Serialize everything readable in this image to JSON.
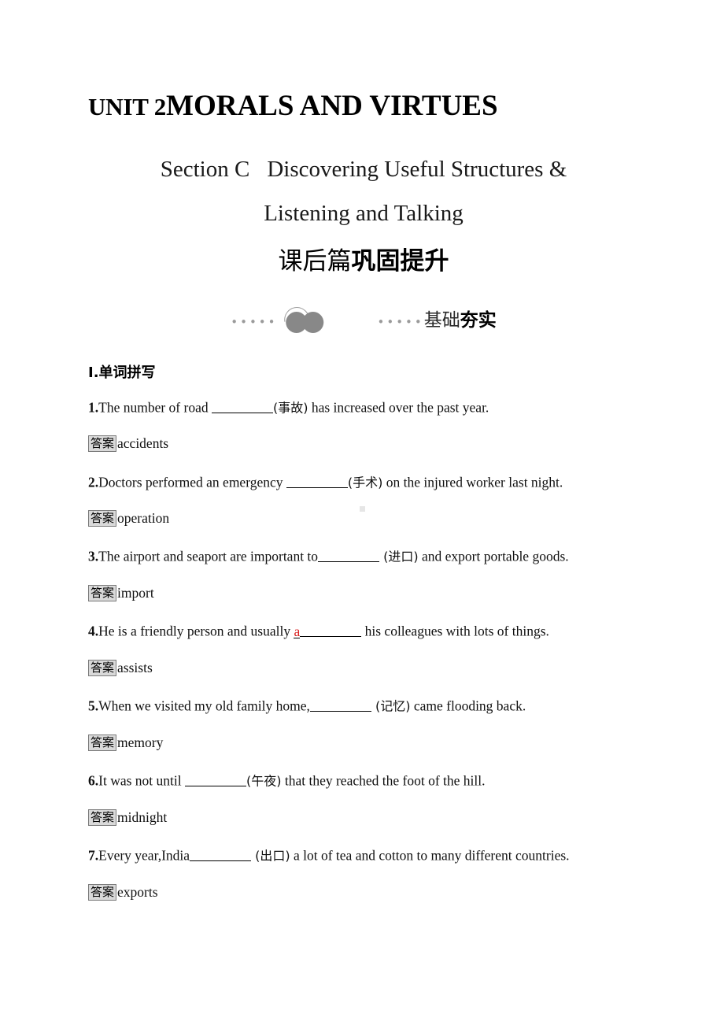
{
  "document": {
    "unit_title_prefix": "UNIT 2",
    "unit_title_main": "MORALS AND VIRTUES",
    "section_line1_a": "Section C",
    "section_line1_b": "Discovering Useful Structures &",
    "section_line2": "Listening and Talking",
    "banner_light": "课后篇",
    "banner_heavy": "巩固提升",
    "deco_label_light": "基础",
    "deco_label_heavy": "夯实",
    "deco_dots_left": "•••••",
    "deco_dots_right": "•••••",
    "section_heading": "Ⅰ.单词拼写",
    "answer_badge": "答案"
  },
  "questions": [
    {
      "num": "1.",
      "text_before": "The number of road ",
      "blank": true,
      "pre_letter": "",
      "hint": "(事故)",
      "text_after": " has increased over the past year.",
      "answer": "accidents"
    },
    {
      "num": "2.",
      "text_before": "Doctors performed an emergency ",
      "blank": true,
      "pre_letter": "",
      "hint": "(手术)",
      "text_after": " on the injured worker last night.",
      "answer": "operation"
    },
    {
      "num": "3.",
      "text_before": "The airport and seaport are important to",
      "blank": true,
      "pre_letter": "",
      "hint": " (进口)",
      "text_after": " and export portable goods.",
      "answer": "import"
    },
    {
      "num": "4.",
      "text_before": "He is a friendly person and usually ",
      "blank": true,
      "pre_letter": "a",
      "hint": "",
      "text_after": " his colleagues with lots of things.",
      "answer": "assists"
    },
    {
      "num": "5.",
      "text_before": "When we visited my old family home,",
      "blank": true,
      "pre_letter": "",
      "hint": " (记忆)",
      "text_after": " came flooding back.",
      "answer": "memory"
    },
    {
      "num": "6.",
      "text_before": "It was not until ",
      "blank": true,
      "pre_letter": "",
      "hint": "(午夜)",
      "text_after": " that they reached the foot of the hill.",
      "answer": "midnight"
    },
    {
      "num": "7.",
      "text_before": "Every year,India",
      "blank": true,
      "pre_letter": "",
      "hint": " (出口)",
      "text_after": " a lot of tea and cotton to many different countries.",
      "answer": "exports"
    }
  ],
  "colors": {
    "page_background": "#ffffff",
    "text": "#101010",
    "badge_background": "#d9d9d9",
    "badge_border": "#7a7a7a",
    "decoration_gray": "#888888",
    "highlight_red": "#d81f1f"
  }
}
